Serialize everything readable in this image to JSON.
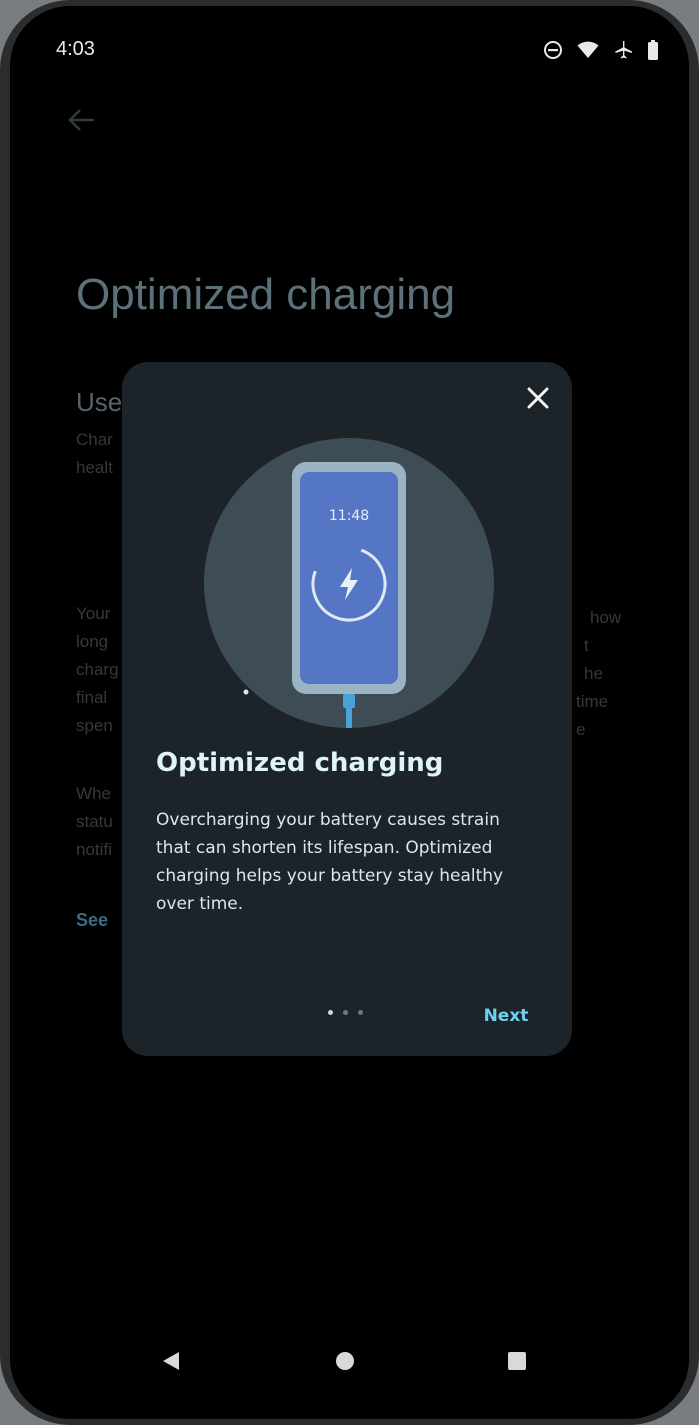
{
  "status_bar": {
    "time": "4:03",
    "icons": [
      "do-not-disturb-icon",
      "wifi-icon",
      "airplane-icon",
      "battery-icon"
    ]
  },
  "background_page": {
    "title": "Optimized charging",
    "heading_partial": "Use",
    "lines_partial": [
      "Char",
      "healt"
    ],
    "paragraph_left": [
      "Your",
      "long",
      "charg",
      "final",
      "spen"
    ],
    "paragraph_right": [
      "how",
      "t",
      "he",
      "time",
      "e"
    ],
    "paragraph2_left": [
      "Whe",
      "statu",
      "notifi"
    ],
    "link_partial": "See"
  },
  "dialog": {
    "close_icon": "close-icon",
    "illustration": {
      "phone_time": "11:48",
      "icon": "charging-bolt-icon"
    },
    "title": "Optimized charging",
    "body": "Overcharging your battery causes strain that can shorten its lifespan. Optimized charging helps your battery stay healthy over time.",
    "page_indicator": {
      "total": 3,
      "current": 1
    },
    "next_label": "Next"
  },
  "nav_bar": {
    "back": "back-icon",
    "home": "home-icon",
    "recents": "recents-icon"
  },
  "colors": {
    "dialog_bg": "#1d2429",
    "accent": "#6dd2f2",
    "illustration_circle": "#3e4d55",
    "phone_screen": "#5476c4"
  }
}
